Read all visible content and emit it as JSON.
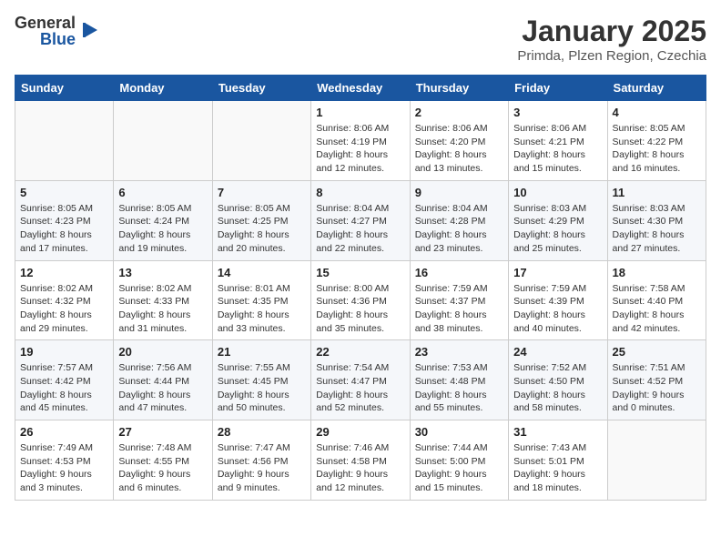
{
  "logo": {
    "general": "General",
    "blue": "Blue"
  },
  "title": "January 2025",
  "subtitle": "Primda, Plzen Region, Czechia",
  "days_of_week": [
    "Sunday",
    "Monday",
    "Tuesday",
    "Wednesday",
    "Thursday",
    "Friday",
    "Saturday"
  ],
  "weeks": [
    [
      {
        "day": "",
        "info": ""
      },
      {
        "day": "",
        "info": ""
      },
      {
        "day": "",
        "info": ""
      },
      {
        "day": "1",
        "info": "Sunrise: 8:06 AM\nSunset: 4:19 PM\nDaylight: 8 hours\nand 12 minutes."
      },
      {
        "day": "2",
        "info": "Sunrise: 8:06 AM\nSunset: 4:20 PM\nDaylight: 8 hours\nand 13 minutes."
      },
      {
        "day": "3",
        "info": "Sunrise: 8:06 AM\nSunset: 4:21 PM\nDaylight: 8 hours\nand 15 minutes."
      },
      {
        "day": "4",
        "info": "Sunrise: 8:05 AM\nSunset: 4:22 PM\nDaylight: 8 hours\nand 16 minutes."
      }
    ],
    [
      {
        "day": "5",
        "info": "Sunrise: 8:05 AM\nSunset: 4:23 PM\nDaylight: 8 hours\nand 17 minutes."
      },
      {
        "day": "6",
        "info": "Sunrise: 8:05 AM\nSunset: 4:24 PM\nDaylight: 8 hours\nand 19 minutes."
      },
      {
        "day": "7",
        "info": "Sunrise: 8:05 AM\nSunset: 4:25 PM\nDaylight: 8 hours\nand 20 minutes."
      },
      {
        "day": "8",
        "info": "Sunrise: 8:04 AM\nSunset: 4:27 PM\nDaylight: 8 hours\nand 22 minutes."
      },
      {
        "day": "9",
        "info": "Sunrise: 8:04 AM\nSunset: 4:28 PM\nDaylight: 8 hours\nand 23 minutes."
      },
      {
        "day": "10",
        "info": "Sunrise: 8:03 AM\nSunset: 4:29 PM\nDaylight: 8 hours\nand 25 minutes."
      },
      {
        "day": "11",
        "info": "Sunrise: 8:03 AM\nSunset: 4:30 PM\nDaylight: 8 hours\nand 27 minutes."
      }
    ],
    [
      {
        "day": "12",
        "info": "Sunrise: 8:02 AM\nSunset: 4:32 PM\nDaylight: 8 hours\nand 29 minutes."
      },
      {
        "day": "13",
        "info": "Sunrise: 8:02 AM\nSunset: 4:33 PM\nDaylight: 8 hours\nand 31 minutes."
      },
      {
        "day": "14",
        "info": "Sunrise: 8:01 AM\nSunset: 4:35 PM\nDaylight: 8 hours\nand 33 minutes."
      },
      {
        "day": "15",
        "info": "Sunrise: 8:00 AM\nSunset: 4:36 PM\nDaylight: 8 hours\nand 35 minutes."
      },
      {
        "day": "16",
        "info": "Sunrise: 7:59 AM\nSunset: 4:37 PM\nDaylight: 8 hours\nand 38 minutes."
      },
      {
        "day": "17",
        "info": "Sunrise: 7:59 AM\nSunset: 4:39 PM\nDaylight: 8 hours\nand 40 minutes."
      },
      {
        "day": "18",
        "info": "Sunrise: 7:58 AM\nSunset: 4:40 PM\nDaylight: 8 hours\nand 42 minutes."
      }
    ],
    [
      {
        "day": "19",
        "info": "Sunrise: 7:57 AM\nSunset: 4:42 PM\nDaylight: 8 hours\nand 45 minutes."
      },
      {
        "day": "20",
        "info": "Sunrise: 7:56 AM\nSunset: 4:44 PM\nDaylight: 8 hours\nand 47 minutes."
      },
      {
        "day": "21",
        "info": "Sunrise: 7:55 AM\nSunset: 4:45 PM\nDaylight: 8 hours\nand 50 minutes."
      },
      {
        "day": "22",
        "info": "Sunrise: 7:54 AM\nSunset: 4:47 PM\nDaylight: 8 hours\nand 52 minutes."
      },
      {
        "day": "23",
        "info": "Sunrise: 7:53 AM\nSunset: 4:48 PM\nDaylight: 8 hours\nand 55 minutes."
      },
      {
        "day": "24",
        "info": "Sunrise: 7:52 AM\nSunset: 4:50 PM\nDaylight: 8 hours\nand 58 minutes."
      },
      {
        "day": "25",
        "info": "Sunrise: 7:51 AM\nSunset: 4:52 PM\nDaylight: 9 hours\nand 0 minutes."
      }
    ],
    [
      {
        "day": "26",
        "info": "Sunrise: 7:49 AM\nSunset: 4:53 PM\nDaylight: 9 hours\nand 3 minutes."
      },
      {
        "day": "27",
        "info": "Sunrise: 7:48 AM\nSunset: 4:55 PM\nDaylight: 9 hours\nand 6 minutes."
      },
      {
        "day": "28",
        "info": "Sunrise: 7:47 AM\nSunset: 4:56 PM\nDaylight: 9 hours\nand 9 minutes."
      },
      {
        "day": "29",
        "info": "Sunrise: 7:46 AM\nSunset: 4:58 PM\nDaylight: 9 hours\nand 12 minutes."
      },
      {
        "day": "30",
        "info": "Sunrise: 7:44 AM\nSunset: 5:00 PM\nDaylight: 9 hours\nand 15 minutes."
      },
      {
        "day": "31",
        "info": "Sunrise: 7:43 AM\nSunset: 5:01 PM\nDaylight: 9 hours\nand 18 minutes."
      },
      {
        "day": "",
        "info": ""
      }
    ]
  ]
}
